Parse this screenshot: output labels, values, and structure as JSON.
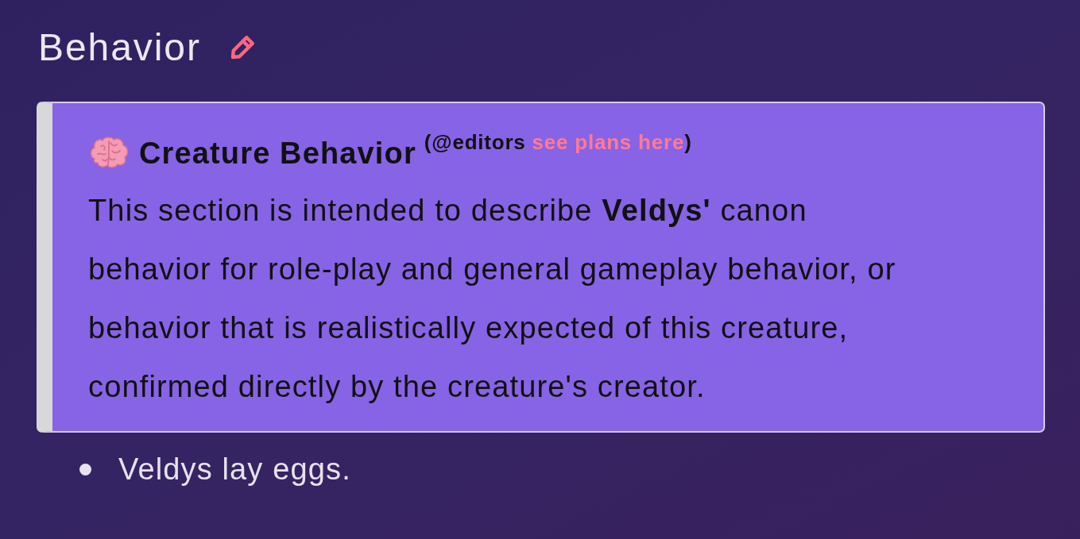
{
  "section": {
    "title": "Behavior"
  },
  "callout": {
    "title": "Creature Behavior",
    "note_parts": [
      {
        "kind": "text",
        "text": "(@editors "
      },
      {
        "kind": "link",
        "text": "see plans here"
      },
      {
        "kind": "text",
        "text": ")"
      }
    ],
    "body": "This section is intended to describe **Veldys'** canon behavior for role-play and general gameplay behavior, or behavior that is realistically expected of this creature, confirmed directly by the creature's creator."
  },
  "list": [
    "Veldys lay eggs."
  ]
}
